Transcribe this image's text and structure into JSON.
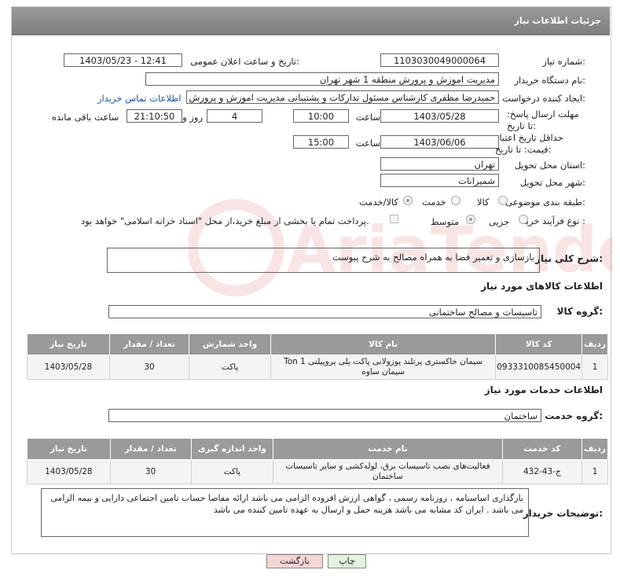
{
  "header": {
    "title": "جزئیات اطلاعات نیاز"
  },
  "fields": {
    "need_number_label": "شماره نیاز:",
    "need_number": "1103030049000064",
    "announce_label": "تاریخ و ساعت اعلان عمومی:",
    "announce_value": "1403/05/23 - 12:41",
    "buyer_label": "نام دستگاه خریدار:",
    "buyer_value": "مدیریت اموزش و پرورش منطقه 1 شهر تهران",
    "creator_label": "ایجاد کننده درخواست:",
    "creator_value": "حمیدرضا مظفری کارشناس مسئول تدارکات و پشتیبانی مدیریت اموزش و پرورش",
    "contact_link": "اطلاعات تماس خریدار",
    "deadline_label": "مهلت ارسال پاسخ: تا تاریخ:",
    "deadline_date": "1403/05/28",
    "time_label": "ساعت",
    "deadline_time": "10:00",
    "days_value": "4",
    "days_label": "روز و",
    "remaining_time": "21:10:50",
    "remaining_label": "ساعت باقی مانده",
    "validity_label": "حداقل تاریخ اعتبار قیمت: تا تاریخ:",
    "validity_date": "1403/06/06",
    "validity_time": "15:00",
    "province_label": "استان محل تحویل:",
    "province_value": "تهران",
    "city_label": "شهر محل تحویل:",
    "city_value": "شمیرانات",
    "category_label": "طبقه بندی موضوعی:",
    "category_options": [
      "کالا",
      "خدمت",
      "کالا/خدمت"
    ],
    "category_selected": "کالا/خدمت",
    "process_label": "نوع فرآیند خرید :",
    "process_options": [
      "جزیی",
      "متوسط"
    ],
    "process_selected": "متوسط",
    "payment_note": "پرداخت تمام یا بخشی از مبلغ خرید،از محل \"اسناد خزانه اسلامی\" خواهد بود."
  },
  "description": {
    "label": "شرح کلی نیاز:",
    "value": "بازسازی و تعمیر فضا به همراه مصالح به شرح پیوست"
  },
  "goods": {
    "section_title": "اطلاعات کالاهای مورد نیاز",
    "group_label": "گروه کالا:",
    "group_value": "تاسیسات و مصالح ساختمانی",
    "columns": [
      "ردیف",
      "کد کالا",
      "نام کالا",
      "واحد شمارش",
      "تعداد / مقدار",
      "تاریخ نیاز"
    ],
    "rows": [
      [
        "1",
        "0933310085450004",
        "سیمان خاکستری پرتلند پوزولانی پاکت پلی پروپیلنی 1 Ton سیمان ساوه",
        "پاکت",
        "30",
        "1403/05/28"
      ]
    ]
  },
  "services": {
    "section_title": "اطلاعات خدمات مورد نیاز",
    "group_label": "گروه خدمت:",
    "group_value": "ساختمان",
    "columns": [
      "ردیف",
      "کد خدمت",
      "نام خدمت",
      "واحد اندازه گیری",
      "تعداد / مقدار",
      "تاریخ نیاز"
    ],
    "rows": [
      [
        "1",
        "ج-43-432",
        "فعالیت‌های نصب تاسیسات برق، لوله‌کشی و سایر تاسیسات ساختمان",
        "پاکت",
        "30",
        "1403/05/28"
      ]
    ]
  },
  "buyer_notes": {
    "label": "توضیحات خریدار:",
    "value": "بارگذاری اساسنامه ، روزنامه رسمی ، گواهی ارزش افزوده الزامی می باشد ارائه مفاصا حساب تامین اجتماعی دارایی و بیمه الزامی می باشد . ایران کد مشابه می باشد هزینه حمل و ارسال به عهده تامین کننده می باشد"
  },
  "buttons": {
    "print": "چاپ",
    "back": "بازگشت"
  },
  "watermark": "AriaTender.neT",
  "colors": {
    "header_bg": "#8c8c8c",
    "link": "#1a55a0",
    "back_btn": "#f6d5d5",
    "print_btn": "#e3f3dd"
  }
}
